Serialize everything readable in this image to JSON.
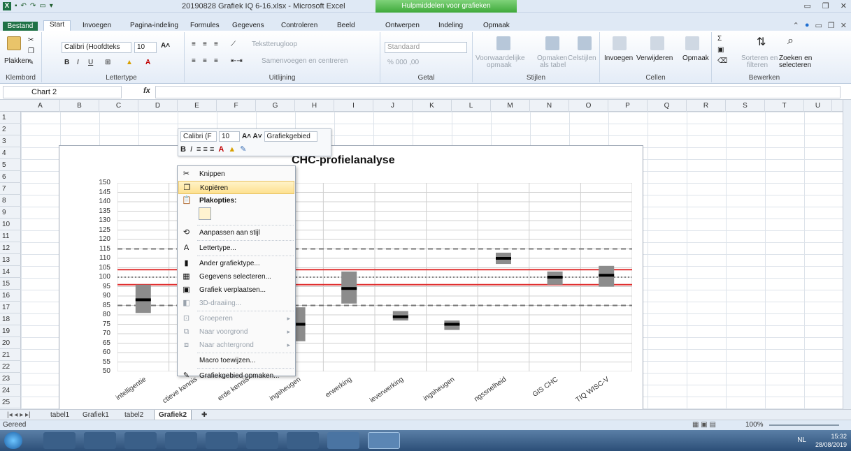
{
  "window": {
    "title": "20190828 Grafiek IQ 6-16.xlsx - Microsoft Excel",
    "context_tab_group": "Hulpmiddelen voor grafieken"
  },
  "ribbon_tabs": [
    "Bestand",
    "Start",
    "Invoegen",
    "Pagina-indeling",
    "Formules",
    "Gegevens",
    "Controleren",
    "Beeld",
    "Ontwerpen",
    "Indeling",
    "Opmaak"
  ],
  "ribbon": {
    "clipboard": {
      "paste": "Plakken",
      "label": "Klembord"
    },
    "font": {
      "name": "Calibri (Hoofdteks",
      "size": "10",
      "label": "Lettertype"
    },
    "alignment": {
      "wrap": "Tekstterugloop",
      "merge": "Samenvoegen en centreren",
      "label": "Uitlijning"
    },
    "number": {
      "format": "Standaard",
      "label": "Getal"
    },
    "styles": {
      "cond": "Voorwaardelijke",
      "cond2": "opmaak",
      "table": "Opmaken",
      "table2": "als tabel",
      "cell": "Celstijlen",
      "label": "Stijlen"
    },
    "cells": {
      "insert": "Invoegen",
      "delete": "Verwijderen",
      "format": "Opmaak",
      "label": "Cellen"
    },
    "editing": {
      "sort": "Sorteren en",
      "sort2": "filteren",
      "find": "Zoeken en",
      "find2": "selecteren",
      "label": "Bewerken"
    }
  },
  "formula_bar": {
    "name_box": "Chart 2",
    "fx": "fx",
    "formula": ""
  },
  "columns": [
    "A",
    "B",
    "C",
    "D",
    "E",
    "F",
    "G",
    "H",
    "I",
    "J",
    "K",
    "L",
    "M",
    "N",
    "O",
    "P",
    "Q",
    "R",
    "S",
    "T",
    "U"
  ],
  "rows": [
    "1",
    "2",
    "3",
    "4",
    "5",
    "6",
    "7",
    "8",
    "9",
    "10",
    "11",
    "12",
    "13",
    "14",
    "15",
    "16",
    "17",
    "18",
    "19",
    "20",
    "21",
    "22",
    "23",
    "24",
    "25"
  ],
  "mini_toolbar": {
    "font": "Calibri (F",
    "size": "10",
    "element": "Grafiekgebied",
    "bold": "B",
    "italic": "I"
  },
  "context_menu": [
    {
      "label": "Knippen",
      "icon": "scissors-icon",
      "state": "normal"
    },
    {
      "label": "Kopiëren",
      "icon": "copy-icon",
      "state": "highlighted"
    },
    {
      "label": "Plakopties:",
      "icon": "paste-icon",
      "state": "bold"
    },
    {
      "label": "Aanpassen aan stijl",
      "icon": "reset-style-icon",
      "state": "normal"
    },
    {
      "label": "Lettertype...",
      "icon": "font-icon",
      "state": "normal"
    },
    {
      "label": "Ander grafiektype...",
      "icon": "chart-type-icon",
      "state": "normal"
    },
    {
      "label": "Gegevens selecteren...",
      "icon": "select-data-icon",
      "state": "normal"
    },
    {
      "label": "Grafiek verplaatsen...",
      "icon": "move-chart-icon",
      "state": "normal"
    },
    {
      "label": "3D-draaiing...",
      "icon": "rotate-3d-icon",
      "state": "disabled"
    },
    {
      "label": "Groeperen",
      "icon": "group-icon",
      "state": "disabled"
    },
    {
      "label": "Naar voorgrond",
      "icon": "bring-front-icon",
      "state": "disabled"
    },
    {
      "label": "Naar achtergrond",
      "icon": "send-back-icon",
      "state": "disabled"
    },
    {
      "label": "Macro toewijzen...",
      "icon": "",
      "state": "normal"
    },
    {
      "label": "Grafiekgebied opmaken...",
      "icon": "format-chart-icon",
      "state": "normal"
    }
  ],
  "chart_data": {
    "type": "box",
    "title": "CHC-profielanalyse",
    "ylim": [
      50,
      150
    ],
    "yticks": [
      50,
      55,
      60,
      65,
      70,
      75,
      80,
      85,
      90,
      95,
      100,
      105,
      110,
      115,
      120,
      125,
      130,
      135,
      140,
      145,
      150
    ],
    "categories": [
      "intelligentie",
      "ctieve kennis",
      "erde kennis",
      "ingsheugen",
      "erwerking",
      "ieverwerking",
      "ingsheugen",
      "ngssnelheid",
      "GIS CHC",
      "TIQ WISC-V"
    ],
    "center": [
      88,
      null,
      null,
      75,
      94,
      79,
      75,
      110,
      100,
      101
    ],
    "low": [
      81,
      null,
      null,
      66,
      86,
      77,
      72,
      107,
      96,
      95
    ],
    "high": [
      96,
      null,
      null,
      84,
      103,
      82,
      77,
      113,
      103,
      106
    ],
    "reference_lines": [
      {
        "value": 115,
        "style": "dashed",
        "color": "#777777"
      },
      {
        "value": 104,
        "style": "solid",
        "color": "#e03030"
      },
      {
        "value": 100,
        "style": "dotted",
        "color": "#888888"
      },
      {
        "value": 96,
        "style": "solid",
        "color": "#e03030"
      },
      {
        "value": 85,
        "style": "dashed",
        "color": "#777777"
      }
    ],
    "grid": true,
    "legend": "none"
  },
  "sheet_tabs": [
    "tabel1",
    "Grafiek1",
    "tabel2",
    "Grafiek2"
  ],
  "active_sheet": "Grafiek2",
  "status": {
    "ready": "Gereed",
    "zoom": "100%"
  },
  "taskbar": {
    "lang": "NL",
    "time": "15:32",
    "date": "28/08/2019"
  },
  "colors": {
    "excel_green": "#1e7145",
    "box_fill": "#8c8c8c",
    "ref_red": "#e03030",
    "ribbon_bg": "#dfe9f5"
  }
}
